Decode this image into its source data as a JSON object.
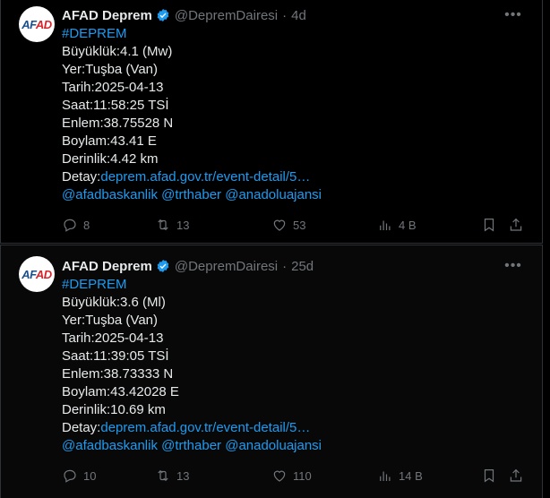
{
  "tweets": [
    {
      "author_name": "AFAD Deprem",
      "handle": "@DepremDairesi",
      "dot": "·",
      "time": "4d",
      "avatar_text_a": "AF",
      "avatar_text_b": "AD",
      "hashtag": "#DEPREM",
      "lines": {
        "magnitude": "Büyüklük:4.1 (Mw)",
        "place": "Yer:Tuşba (Van)",
        "date": "Tarih:2025-04-13",
        "time": "Saat:11:58:25 TSİ",
        "lat": "Enlem:38.75528 N",
        "lon": "Boylam:43.41 E",
        "depth": "Derinlik:4.42 km",
        "detail_label": "Detay:",
        "detail_link": "deprem.afad.gov.tr/event-detail/5…",
        "mentions": "@afadbaskanlik @trthaber @anadoluajansi"
      },
      "stats": {
        "replies": "8",
        "retweets": "13",
        "likes": "53",
        "views": "4 B"
      }
    },
    {
      "author_name": "AFAD Deprem",
      "handle": "@DepremDairesi",
      "dot": "·",
      "time": "25d",
      "avatar_text_a": "AF",
      "avatar_text_b": "AD",
      "hashtag": "#DEPREM",
      "lines": {
        "magnitude": "Büyüklük:3.6 (Ml)",
        "place": "Yer:Tuşba (Van)",
        "date": "Tarih:2025-04-13",
        "time": "Saat:11:39:05 TSİ",
        "lat": "Enlem:38.73333 N",
        "lon": "Boylam:43.42028 E",
        "depth": "Derinlik:10.69 km",
        "detail_label": "Detay:",
        "detail_link": "deprem.afad.gov.tr/event-detail/5…",
        "mentions": "@afadbaskanlik @trthaber @anadoluajansi"
      },
      "stats": {
        "replies": "10",
        "retweets": "13",
        "likes": "110",
        "views": "14 B"
      }
    }
  ],
  "icons": {
    "verified": "verified-badge-icon",
    "more": "more-options-icon",
    "reply": "reply-icon",
    "retweet": "retweet-icon",
    "like": "heart-icon",
    "views": "views-chart-icon",
    "bookmark": "bookmark-icon",
    "share": "share-icon"
  },
  "colors": {
    "link": "#1d9bf0",
    "muted": "#71767b",
    "text": "#e7e9ea",
    "background": "#000000",
    "verified": "#1d9bf0"
  }
}
